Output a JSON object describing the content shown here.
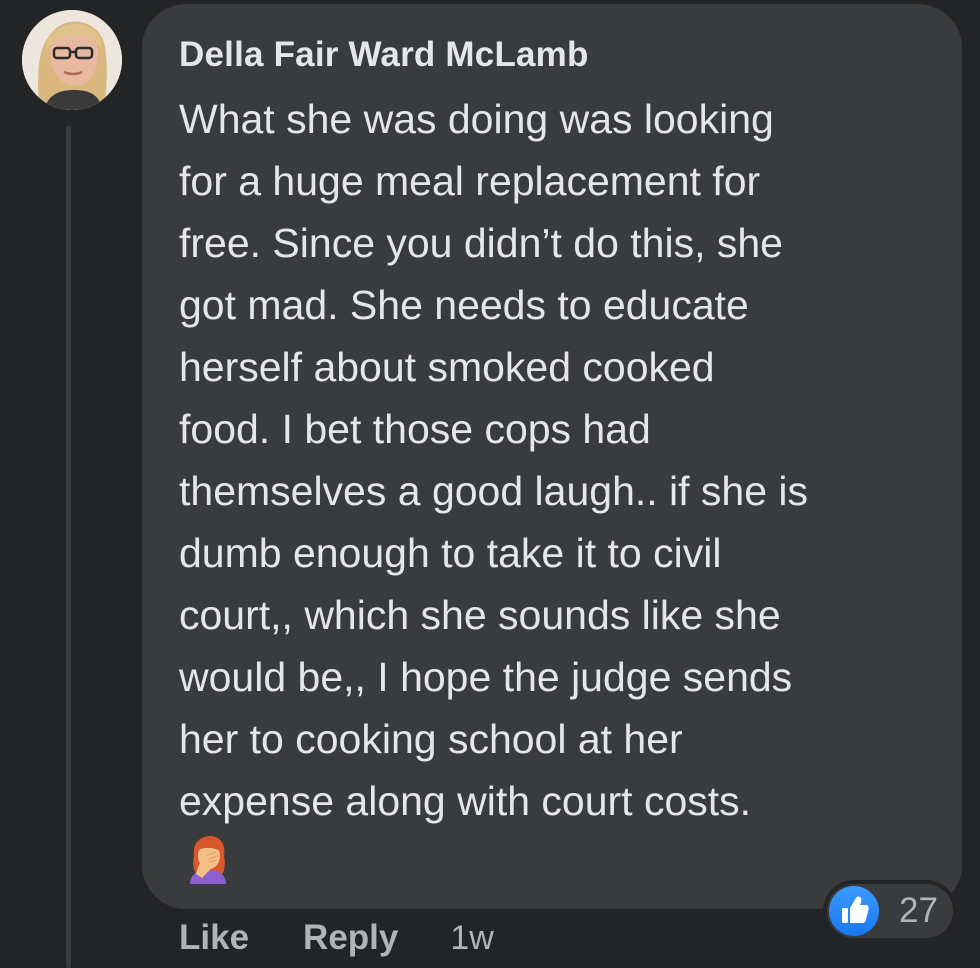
{
  "comment": {
    "author": "Della Fair Ward McLamb",
    "body_lines": [
      "What she was doing was looking",
      "for a huge meal replacement for",
      "free. Since you didn’t do this, she",
      "got mad. She needs to educate",
      "herself about smoked cooked",
      "food. I bet those cops had",
      "themselves a good laugh.. if she is",
      "dumb enough to take it to civil",
      "court,, which she sounds like she",
      "would be,, I hope the judge sends",
      "her to cooking school at her",
      "expense along with court costs."
    ],
    "emoji": "woman-facepalming",
    "timestamp": "1w"
  },
  "reactions": {
    "icon": "like-thumbs-up-icon",
    "count": "27",
    "color": "#1877f2"
  },
  "actions": {
    "like_label": "Like",
    "reply_label": "Reply"
  },
  "colors": {
    "background": "#232426",
    "bubble": "#3a3b3c",
    "text": "#e4e6eb",
    "muted": "#b0b3b8"
  }
}
